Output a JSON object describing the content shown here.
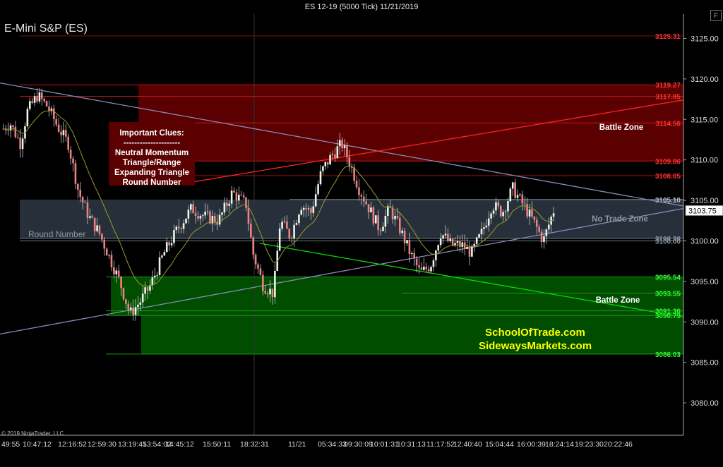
{
  "window": {
    "title": "ES 12-19 (5000 Tick)  11/21/2019",
    "instrument": "E-Mini S&P (ES)",
    "f_button": "F",
    "copyright": "© 2019 NinjaTrader, LLC"
  },
  "clues": {
    "lines": [
      "Important Clues:",
      "---------------------",
      "Neutral Momentum",
      "Triangle/Range",
      "Expanding Triangle",
      "Round Number"
    ]
  },
  "chart_data": {
    "type": "candlestick",
    "ylim": [
      3076,
      3128
    ],
    "y_ticks": [
      3080,
      3085,
      3090,
      3095,
      3100,
      3105,
      3110,
      3115,
      3120,
      3125
    ],
    "x_tick_labels": [
      "49:55",
      "10:47:12",
      "12:16:52",
      "12:59:30",
      "13:19:45",
      "13:54:02",
      "14:45:12",
      "15:50:11",
      "18:32:31",
      "11/21",
      "05:34:33",
      "09:30:09",
      "10:01:31",
      "10:31:13",
      "11:17:52",
      "12:40:40",
      "15:04:44",
      "16:00:39",
      "18:24:14",
      "19:23:30",
      "20:22:46"
    ],
    "last_price": "3103.75",
    "last_price_value": 3103.75,
    "zones": [
      {
        "name": "Battle Zone",
        "top": 3119.27,
        "bottom": 3109.86,
        "color": "#5a0000"
      },
      {
        "name": "No Trade Zone",
        "top": 3105.1,
        "bottom": 3100.3,
        "color": "#2b3540"
      },
      {
        "name": "Battle Zone",
        "top": 3095.54,
        "bottom": 3086.03,
        "color": "#004d00"
      }
    ],
    "levels": [
      {
        "value": 3125.31,
        "label": "3125.31",
        "color": "#ff3333",
        "line": "#7a1010"
      },
      {
        "value": 3119.27,
        "label": "3119.27",
        "color": "#ff3333",
        "line": "#c01818"
      },
      {
        "value": 3117.85,
        "label": "3117.85",
        "color": "#ff3333",
        "line": "#c01818"
      },
      {
        "value": 3114.56,
        "label": "3114.56",
        "color": "#ff3333",
        "line": "#c01818"
      },
      {
        "value": 3109.86,
        "label": "3109.86",
        "color": "#ff3333",
        "line": "#c01818"
      },
      {
        "value": 3108.05,
        "label": "3108.05",
        "color": "#ff3333",
        "line": "#a01010"
      },
      {
        "value": 3105.1,
        "label": "3105.10",
        "color": "#b8c4cc",
        "line": "#8898a4"
      },
      {
        "value": 3100.3,
        "label": "3100.30",
        "color": "#8a96a0",
        "line": "#6c7a86"
      },
      {
        "value": 3100.0,
        "label": "3100.00",
        "color": "#8a96a0",
        "line": "#6c7a86"
      },
      {
        "value": 3095.54,
        "label": "3095.54",
        "color": "#33ff33",
        "line": "#1a9a1a"
      },
      {
        "value": 3093.55,
        "label": "3093.55",
        "color": "#33ff33",
        "line": "#1a9a1a"
      },
      {
        "value": 3091.36,
        "label": "3091.36",
        "color": "#33ff33",
        "line": "#1a9a1a"
      },
      {
        "value": 3090.79,
        "label": "3090.79",
        "color": "#33ff33",
        "line": "#1a9a1a"
      },
      {
        "value": 3086.03,
        "label": "3086.03",
        "color": "#33ff33",
        "line": "#1a9a1a"
      }
    ],
    "annotations": [
      {
        "text": "Battle Zone",
        "color": "#ffffff"
      },
      {
        "text": "No Trade Zone",
        "color": "#8c99a4"
      },
      {
        "text": "Battle Zone",
        "color": "#ffffff"
      },
      {
        "text": "Round Number",
        "color": "#8c99a4"
      },
      {
        "text": "SchoolOfTrade.com",
        "color": "#ffff00"
      },
      {
        "text": "SidewaysMarkets.com",
        "color": "#ffff00"
      }
    ],
    "trendlines": [
      {
        "name": "upper-triangle-line",
        "color": "#8a8ab8",
        "from": [
          0,
          3119.5
        ],
        "to": [
          1,
          3104.3
        ]
      },
      {
        "name": "lower-triangle-line",
        "color": "#8a8ab8",
        "from": [
          0,
          3088.5
        ],
        "to": [
          1,
          3104.0
        ]
      },
      {
        "name": "red-expanding-line",
        "color": "#ff2222",
        "from": [
          0.27,
          3107.1
        ],
        "to": [
          1,
          3117.4
        ]
      },
      {
        "name": "green-expanding-line",
        "color": "#00dd00",
        "from": [
          0.38,
          3099.7
        ],
        "to": [
          1,
          3090.6
        ]
      }
    ],
    "price_path": [
      [
        0.0,
        3113.5
      ],
      [
        0.015,
        3114.5
      ],
      [
        0.03,
        3112.0
      ],
      [
        0.04,
        3116.0
      ],
      [
        0.055,
        3118.0
      ],
      [
        0.07,
        3116.5
      ],
      [
        0.085,
        3114.0
      ],
      [
        0.1,
        3112.0
      ],
      [
        0.115,
        3106.0
      ],
      [
        0.13,
        3103.0
      ],
      [
        0.145,
        3101.0
      ],
      [
        0.16,
        3098.0
      ],
      [
        0.175,
        3095.0
      ],
      [
        0.19,
        3091.0
      ],
      [
        0.205,
        3092.5
      ],
      [
        0.22,
        3094.5
      ],
      [
        0.24,
        3098.5
      ],
      [
        0.26,
        3101.5
      ],
      [
        0.28,
        3104.0
      ],
      [
        0.3,
        3103.0
      ],
      [
        0.32,
        3102.5
      ],
      [
        0.34,
        3106.0
      ],
      [
        0.36,
        3104.5
      ],
      [
        0.37,
        3098.5
      ],
      [
        0.385,
        3094.5
      ],
      [
        0.4,
        3093.5
      ],
      [
        0.41,
        3102.5
      ],
      [
        0.425,
        3100.5
      ],
      [
        0.44,
        3104.5
      ],
      [
        0.455,
        3103.5
      ],
      [
        0.47,
        3108.5
      ],
      [
        0.485,
        3110.5
      ],
      [
        0.5,
        3112.0
      ],
      [
        0.51,
        3110.0
      ],
      [
        0.525,
        3106.5
      ],
      [
        0.54,
        3104.0
      ],
      [
        0.555,
        3101.5
      ],
      [
        0.57,
        3104.0
      ],
      [
        0.585,
        3101.5
      ],
      [
        0.6,
        3098.5
      ],
      [
        0.615,
        3096.0
      ],
      [
        0.63,
        3097.0
      ],
      [
        0.645,
        3101.0
      ],
      [
        0.66,
        3099.5
      ],
      [
        0.675,
        3099.5
      ],
      [
        0.69,
        3098.5
      ],
      [
        0.705,
        3101.0
      ],
      [
        0.72,
        3104.5
      ],
      [
        0.735,
        3103.5
      ],
      [
        0.75,
        3106.5
      ],
      [
        0.765,
        3104.5
      ],
      [
        0.78,
        3102.5
      ],
      [
        0.795,
        3100.0
      ],
      [
        0.81,
        3103.75
      ]
    ]
  }
}
